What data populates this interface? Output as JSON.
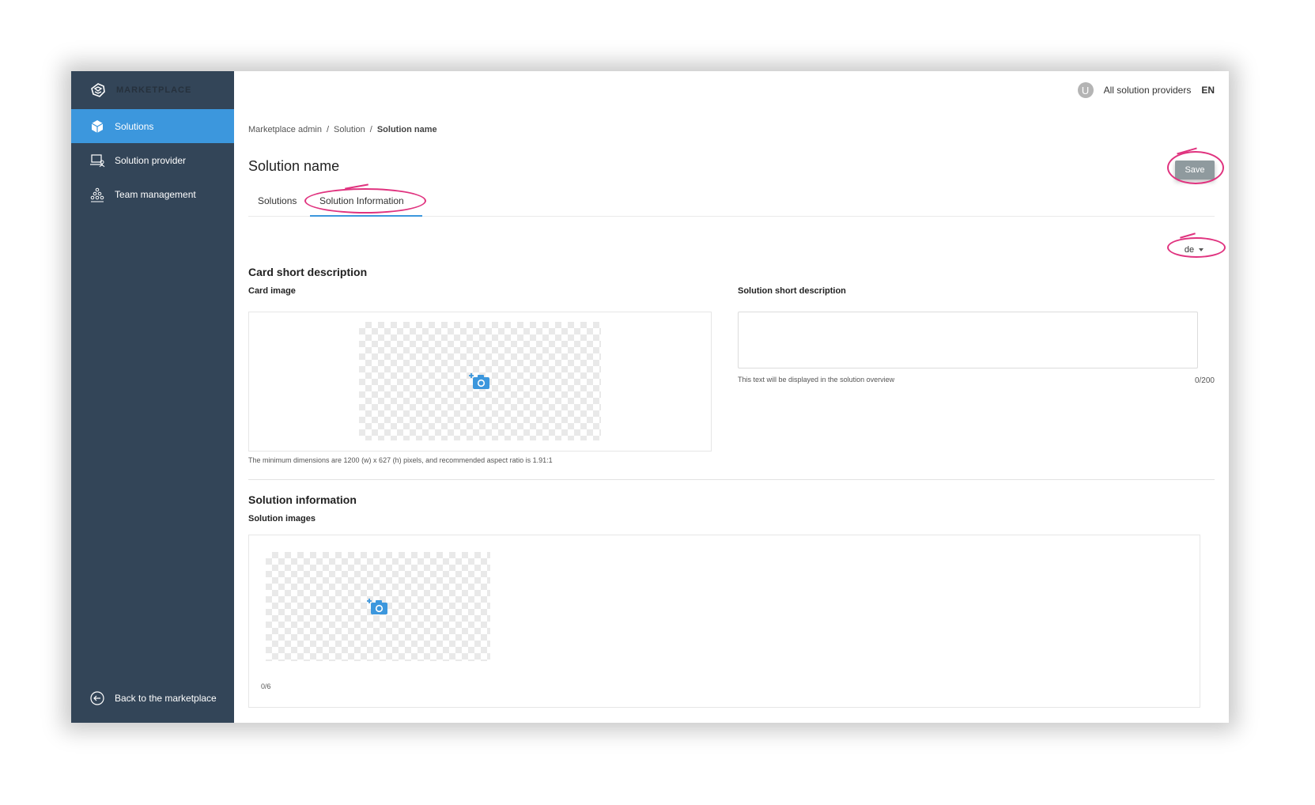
{
  "sidebar": {
    "brand": "MARKETPLACE",
    "items": [
      {
        "label": "Solutions",
        "icon": "cube-icon",
        "active": true
      },
      {
        "label": "Solution provider",
        "icon": "laptop-user-icon",
        "active": false
      },
      {
        "label": "Team management",
        "icon": "team-pyramid-icon",
        "active": false
      }
    ],
    "back_label": "Back to the marketplace"
  },
  "topbar": {
    "avatar_initial": "U",
    "providers_label": "All solution providers",
    "language": "EN"
  },
  "breadcrumb": {
    "items": [
      "Marketplace admin",
      "Solution",
      "Solution name"
    ],
    "separator": "/"
  },
  "page": {
    "title": "Solution name",
    "save_label": "Save"
  },
  "tabs": [
    {
      "label": "Solutions",
      "active": false
    },
    {
      "label": "Solution Information",
      "active": true
    }
  ],
  "language_select": {
    "value": "de"
  },
  "card_section": {
    "title": "Card short description",
    "image_label": "Card image",
    "image_hint": "The minimum dimensions are 1200 (w) x 627 (h) pixels, and recommended aspect ratio is 1.91:1",
    "desc_label": "Solution short description",
    "desc_value": "",
    "desc_hint": "This text will be displayed in the solution overview",
    "desc_counter": "0/200"
  },
  "info_section": {
    "title": "Solution information",
    "images_label": "Solution images",
    "images_counter": "0/6"
  },
  "colors": {
    "sidebar_bg": "#334558",
    "accent": "#3c97dd",
    "annotation": "#e0337f",
    "save_button": "#8f9a9e"
  }
}
